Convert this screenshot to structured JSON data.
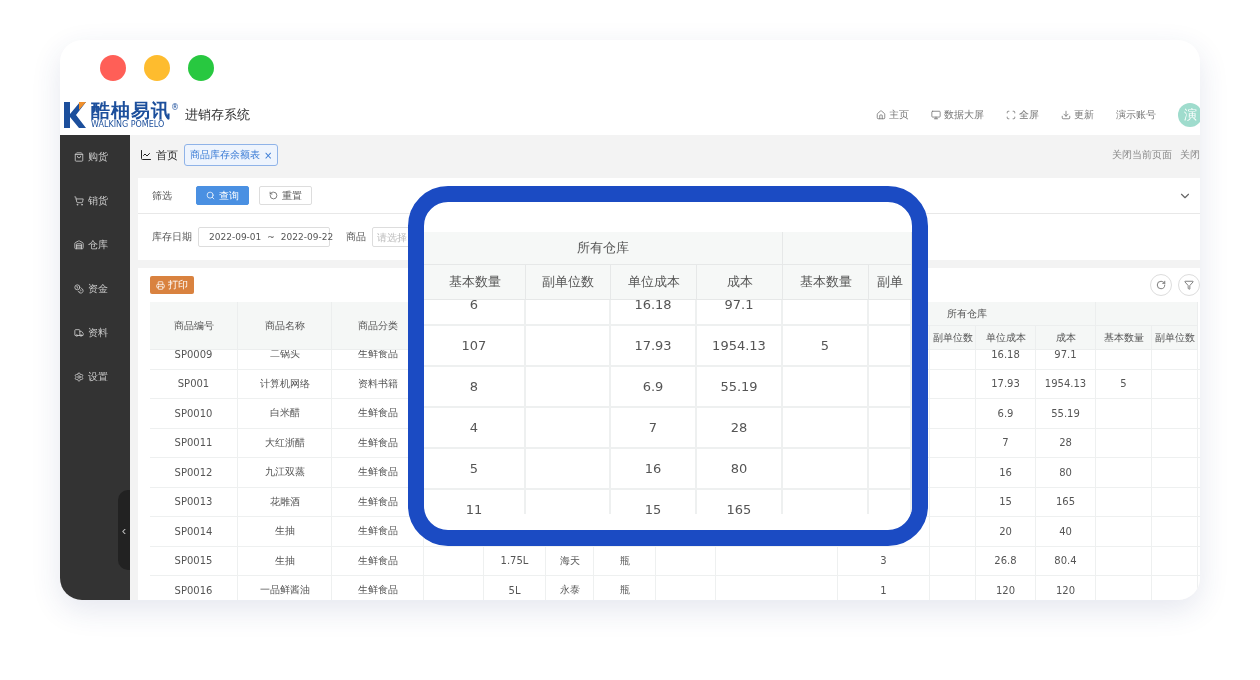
{
  "window": {
    "controls": [
      {
        "color": "#ff5f57"
      },
      {
        "color": "#febc2e"
      },
      {
        "color": "#28c840"
      }
    ]
  },
  "header": {
    "brand": "酷柚易讯",
    "brand_mark": "®",
    "brand_sub": "WALKING POMELO",
    "system": "进销存系统",
    "nav": [
      {
        "kind": "home",
        "label": "主页"
      },
      {
        "kind": "screen",
        "label": "数据大屏"
      },
      {
        "kind": "fullscreen",
        "label": "全屏"
      },
      {
        "kind": "update",
        "label": "更新"
      }
    ],
    "account": "演示账号",
    "avatar": "演"
  },
  "sidebar": {
    "items": [
      {
        "kind": "purchase",
        "label": "购货"
      },
      {
        "kind": "sales",
        "label": "销货"
      },
      {
        "kind": "warehouse",
        "label": "仓库"
      },
      {
        "kind": "funds",
        "label": "资金"
      },
      {
        "kind": "data",
        "label": "资料"
      },
      {
        "kind": "settings",
        "label": "设置"
      }
    ],
    "collapse": "‹"
  },
  "tabs": [
    {
      "label": "首页",
      "selected": false,
      "closable": false
    },
    {
      "label": "商品库存余额表",
      "selected": true,
      "closable": true,
      "close": "×"
    }
  ],
  "tab_actions": [
    "关闭当前页面",
    "关闭"
  ],
  "filter": {
    "title": "筛选",
    "buttons": [
      {
        "kind": "primary",
        "label": "查询"
      },
      {
        "kind": "default",
        "label": "重置"
      }
    ],
    "date": {
      "label": "库存日期",
      "start": "2022-09-01",
      "separator": "~",
      "end": "2022-09-22"
    },
    "product": {
      "label": "商品",
      "placeholder": "请选择"
    }
  },
  "toolbar": {
    "print": "打印"
  },
  "table": {
    "columns": [
      "商品编号",
      "商品名称",
      "商品分类"
    ],
    "group_header": "所有仓库",
    "group_columns": [
      "副单位数",
      "单位成本",
      "成本"
    ],
    "next_columns": [
      "基本数量",
      "副单位数"
    ],
    "rows": [
      {
        "code": "SP0009",
        "name": "二锅头",
        "category": "生鲜食品",
        "unit_cost": "16.18",
        "cost": "97.1"
      },
      {
        "code": "SP001",
        "name": "计算机网络",
        "category": "资料书籍",
        "unit_cost": "17.93",
        "cost": "1954.13",
        "qty2": "5"
      },
      {
        "code": "SP0010",
        "name": "白米醋",
        "category": "生鲜食品",
        "unit_cost": "6.9",
        "cost": "55.19"
      },
      {
        "code": "SP0011",
        "name": "大红浙醋",
        "category": "生鲜食品",
        "unit_cost": "7",
        "cost": "28"
      },
      {
        "code": "SP0012",
        "name": "九江双蒸",
        "category": "生鲜食品",
        "unit_cost": "16",
        "cost": "80"
      },
      {
        "code": "SP0013",
        "name": "花雕酒",
        "category": "生鲜食品",
        "unit_cost": "15",
        "cost": "165"
      },
      {
        "code": "SP0014",
        "name": "生抽",
        "category": "生鲜食品",
        "unit_cost": "20",
        "cost": "40"
      },
      {
        "code": "SP0015",
        "name": "生抽",
        "category": "生鲜食品",
        "spec": "1.75L",
        "brand": "海天",
        "unit": "瓶",
        "qty": "3",
        "unit_cost": "26.8",
        "cost": "80.4"
      },
      {
        "code": "SP0016",
        "name": "一品鲜酱油",
        "category": "生鲜食品",
        "spec": "5L",
        "brand": "永泰",
        "unit": "瓶",
        "qty": "1",
        "unit_cost": "120",
        "cost": "120"
      }
    ]
  },
  "magnifier": {
    "group_header": "所有仓库",
    "columns": [
      "基本数量",
      "副单位数",
      "单位成本",
      "成本",
      "基本数量",
      "副单"
    ],
    "rows": [
      {
        "qty": "6",
        "unit_cost": "16.18",
        "cost": "97.1"
      },
      {
        "qty": "107",
        "unit_cost": "17.93",
        "cost": "1954.13",
        "qty2": "5"
      },
      {
        "qty": "8",
        "unit_cost": "6.9",
        "cost": "55.19"
      },
      {
        "qty": "4",
        "unit_cost": "7",
        "cost": "28"
      },
      {
        "qty": "5",
        "unit_cost": "16",
        "cost": "80"
      },
      {
        "qty": "11",
        "unit_cost": "15",
        "cost": "165"
      }
    ]
  }
}
